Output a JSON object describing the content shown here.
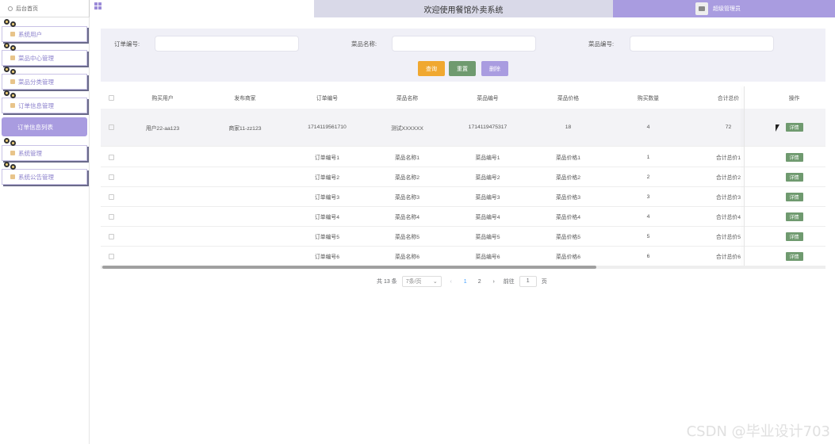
{
  "topbar": {
    "home_tab": "后台首页",
    "title": "欢迎使用餐馆外卖系统",
    "user_role": "超级管理员"
  },
  "sidebar": {
    "items": [
      {
        "label": "系统用户"
      },
      {
        "label": "菜品中心管理"
      },
      {
        "label": "菜品分类管理"
      },
      {
        "label": "订单信息管理"
      },
      {
        "label": "订单信息列表",
        "active": true
      },
      {
        "label": "系统管理"
      },
      {
        "label": "系统公告管理"
      }
    ]
  },
  "search": {
    "order_no_label": "订单编号:",
    "dish_name_label": "菜品名称:",
    "dish_no_label": "菜品编号:",
    "query_btn": "查询",
    "reset_btn": "重置",
    "delete_btn": "删除"
  },
  "table": {
    "headers": [
      "购买用户",
      "发布商家",
      "订单编号",
      "菜品名称",
      "菜品编号",
      "菜品价格",
      "购买数量",
      "合计总价",
      "操作"
    ],
    "detail_btn": "详情",
    "rows": [
      [
        "用户22-aa123",
        "商家11-zz123",
        "1714119561710",
        "测试XXXXXX",
        "1714119475317",
        "18",
        "4",
        "72"
      ],
      [
        "",
        "",
        "订单编号1",
        "菜品名称1",
        "菜品编号1",
        "菜品价格1",
        "1",
        "合计总价1"
      ],
      [
        "",
        "",
        "订单编号2",
        "菜品名称2",
        "菜品编号2",
        "菜品价格2",
        "2",
        "合计总价2"
      ],
      [
        "",
        "",
        "订单编号3",
        "菜品名称3",
        "菜品编号3",
        "菜品价格3",
        "3",
        "合计总价3"
      ],
      [
        "",
        "",
        "订单编号4",
        "菜品名称4",
        "菜品编号4",
        "菜品价格4",
        "4",
        "合计总价4"
      ],
      [
        "",
        "",
        "订单编号5",
        "菜品名称5",
        "菜品编号5",
        "菜品价格5",
        "5",
        "合计总价5"
      ],
      [
        "",
        "",
        "订单编号6",
        "菜品名称6",
        "菜品编号6",
        "菜品价格6",
        "6",
        "合计总价6"
      ]
    ]
  },
  "pager": {
    "total": "共 13 条",
    "page_size": "7条/页",
    "pages": [
      "1",
      "2"
    ],
    "current": "1",
    "goto_label": "前往",
    "goto_value": "1",
    "page_suffix": "页"
  },
  "watermark": "CSDN @毕业设计703",
  "colors": {
    "accent": "#a99ce0",
    "query": "#f0a830",
    "reset": "#6f9a6f",
    "delete": "#a99ce0",
    "detail": "#6f9a6f"
  }
}
